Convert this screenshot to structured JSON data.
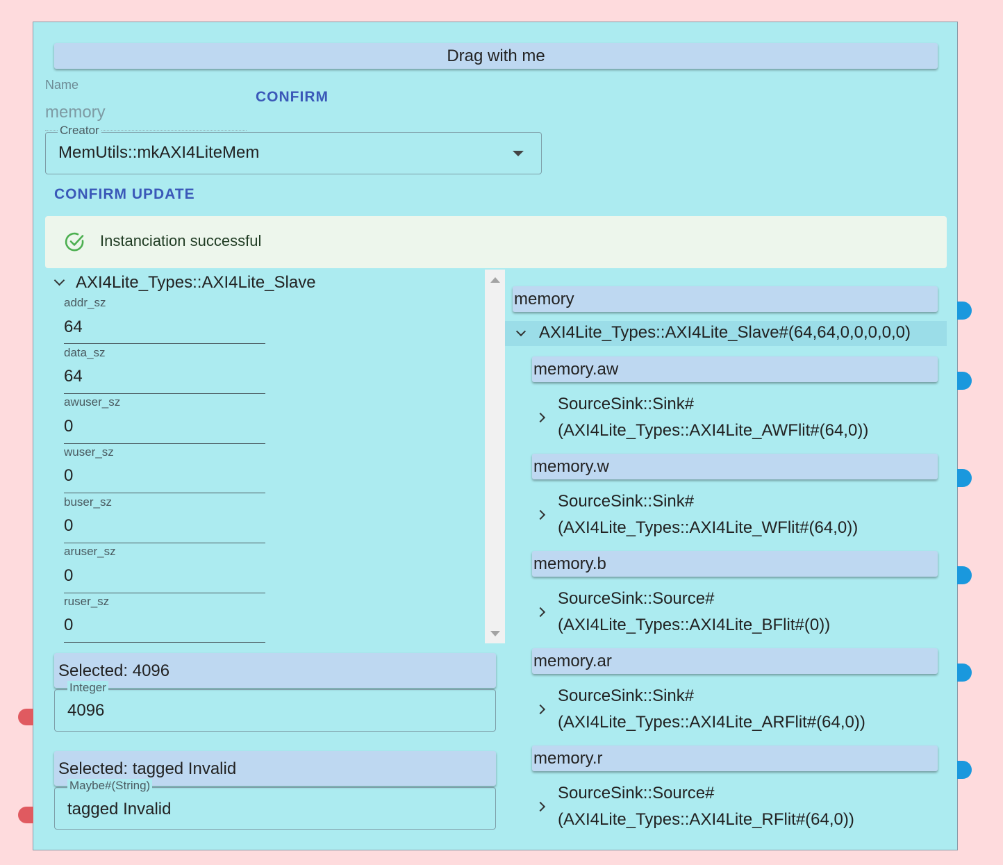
{
  "drag_bar": {
    "label": "Drag with me"
  },
  "name_field": {
    "label": "Name",
    "value": "memory"
  },
  "confirm_label": "CONFIRM",
  "creator": {
    "legend": "Creator",
    "value": "MemUtils::mkAXI4LiteMem"
  },
  "confirm_update_label": "CONFIRM UPDATE",
  "alert": {
    "text": "Instanciation successful",
    "icon": "check-circle-icon",
    "color": "#4caf50"
  },
  "params": {
    "type_name": "AXI4Lite_Types::AXI4Lite_Slave",
    "fields": [
      {
        "label": "addr_sz",
        "value": "64"
      },
      {
        "label": "data_sz",
        "value": "64"
      },
      {
        "label": "awuser_sz",
        "value": "0"
      },
      {
        "label": "wuser_sz",
        "value": "0"
      },
      {
        "label": "buser_sz",
        "value": "0"
      },
      {
        "label": "aruser_sz",
        "value": "0"
      },
      {
        "label": "ruser_sz",
        "value": "0"
      }
    ]
  },
  "inputs": [
    {
      "selected": "Selected: 4096",
      "legend": "Integer",
      "value": "4096"
    },
    {
      "selected": "Selected: tagged Invalid",
      "legend": "Maybe#(String)",
      "value": "tagged Invalid"
    }
  ],
  "outputs": {
    "root_name": "memory",
    "root_type": "AXI4Lite_Types::AXI4Lite_Slave#(64,64,0,0,0,0,0)",
    "children": [
      {
        "name": "memory.aw",
        "line1": "SourceSink::Sink#",
        "line2": "(AXI4Lite_Types::AXI4Lite_AWFlit#(64,0))"
      },
      {
        "name": "memory.w",
        "line1": "SourceSink::Sink#",
        "line2": "(AXI4Lite_Types::AXI4Lite_WFlit#(64,0))"
      },
      {
        "name": "memory.b",
        "line1": "SourceSink::Source#",
        "line2": "(AXI4Lite_Types::AXI4Lite_BFlit#(0))"
      },
      {
        "name": "memory.ar",
        "line1": "SourceSink::Sink#",
        "line2": "(AXI4Lite_Types::AXI4Lite_ARFlit#(64,0))"
      },
      {
        "name": "memory.r",
        "line1": "SourceSink::Source#",
        "line2": "(AXI4Lite_Types::AXI4Lite_RFlit#(64,0))"
      }
    ]
  },
  "colors": {
    "background": "#fedbdd",
    "node": "#acebf0",
    "bar": "#bed8f1",
    "accent_button": "#3a58b8",
    "port_input": "#e05a60",
    "port_output": "#1a98dd"
  }
}
